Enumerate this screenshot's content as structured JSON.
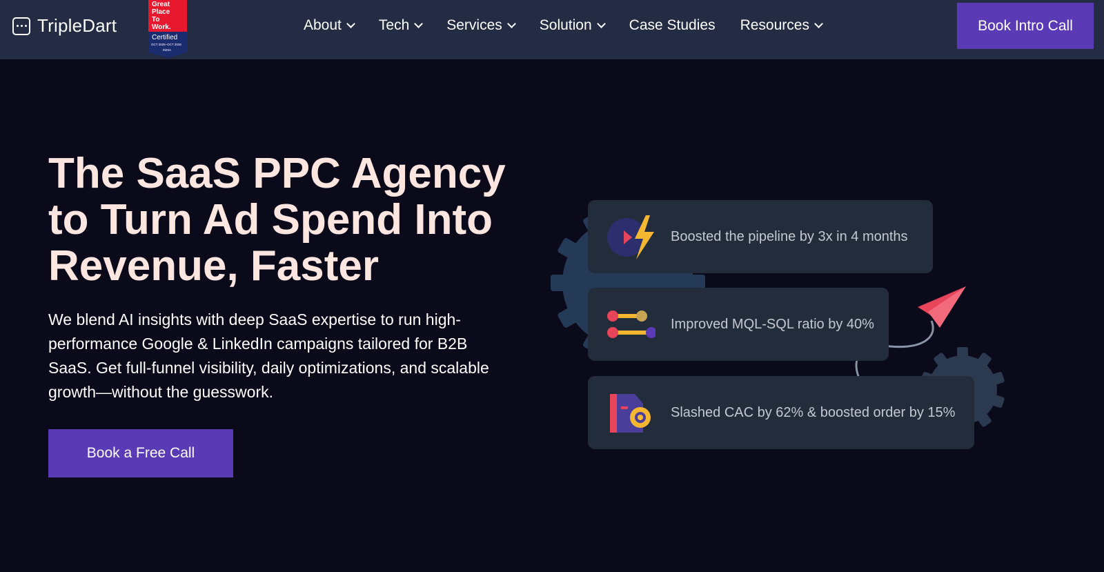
{
  "header": {
    "brand": "TripleDart",
    "badge": {
      "line1": "Great",
      "line2": "Place",
      "line3": "To",
      "line4": "Work.",
      "certified": "Certified",
      "dates": "OCT 2025–OCT 2026",
      "country": "INDIA"
    },
    "nav": [
      {
        "label": "About",
        "dropdown": true
      },
      {
        "label": "Tech",
        "dropdown": true
      },
      {
        "label": "Services",
        "dropdown": true
      },
      {
        "label": "Solution",
        "dropdown": true
      },
      {
        "label": "Case Studies",
        "dropdown": false
      },
      {
        "label": "Resources",
        "dropdown": true
      }
    ],
    "cta": "Book Intro Call"
  },
  "hero": {
    "headline": "The SaaS PPC Agency to Turn Ad Spend Into Revenue, Faster",
    "subtext": "We blend AI insights with deep SaaS expertise to run high-performance Google & LinkedIn campaigns tailored for B2B SaaS. Get full-funnel visibility, daily optimizations, and scalable growth—without the guesswork.",
    "cta": "Book a Free Call"
  },
  "stats": [
    {
      "text": "Boosted the pipeline by 3x in 4 months",
      "icon": "pipeline-bolt-icon"
    },
    {
      "text": "Improved MQL-SQL ratio by 40%",
      "icon": "ratio-sliders-icon"
    },
    {
      "text": "Slashed CAC by 62% & boosted order by 15%",
      "icon": "cac-document-icon"
    }
  ],
  "colors": {
    "background": "#0a0a1b",
    "header": "#232c43",
    "accent": "#5b3ab6",
    "headline": "#fde6df",
    "card": "#232c3b"
  }
}
